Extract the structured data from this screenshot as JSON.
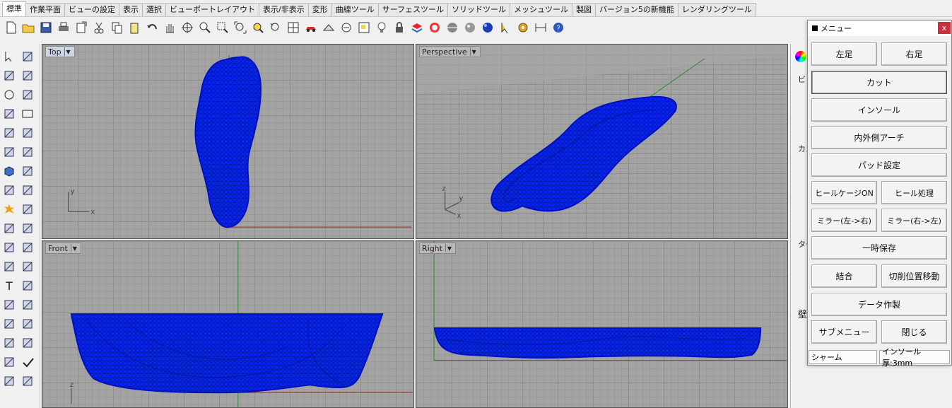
{
  "tabs": [
    "標準",
    "作業平面",
    "ビューの設定",
    "表示",
    "選択",
    "ビューポートレイアウト",
    "表示/非表示",
    "変形",
    "曲線ツール",
    "サーフェスツール",
    "ソリッドツール",
    "メッシュツール",
    "製図",
    "バージョン5の新機能",
    "レンダリングツール"
  ],
  "toolbar_icons": [
    "new-file-icon",
    "open-folder-icon",
    "save-icon",
    "print-icon",
    "import-icon",
    "cut-icon",
    "copy-icon",
    "paste-icon",
    "undo-icon",
    "pan-hand-icon",
    "rotate-view-icon",
    "zoom-icon",
    "zoom-window-icon",
    "zoom-extents-icon",
    "zoom-selected-icon",
    "undo-view-icon",
    "four-viewports-icon",
    "car-icon",
    "object-properties-icon",
    "point-osnap-icon",
    "grid-snap-icon",
    "light-bulb-icon",
    "lock-icon",
    "layer-icon",
    "color-wheel-icon",
    "shaded-sphere-icon",
    "rendered-sphere-icon",
    "blue-sphere-icon",
    "select-arrow-icon",
    "gear-options-icon",
    "dimension-icon",
    "help-icon"
  ],
  "viewports": {
    "top": {
      "label": "Top"
    },
    "perspective": {
      "label": "Perspective"
    },
    "front": {
      "label": "Front"
    },
    "right": {
      "label": "Right"
    }
  },
  "axis_labels": {
    "x": "x",
    "y": "y",
    "z": "z"
  },
  "right_strip": {
    "chars": [
      "ビ",
      "カメ",
      "ター",
      "壁"
    ]
  },
  "menu": {
    "title": "メニュー",
    "close": "x",
    "buttons": {
      "left_foot": "左足",
      "right_foot": "右足",
      "cut": "カット",
      "insole": "インソール",
      "arch": "内外側アーチ",
      "pad": "パッド設定",
      "heel_cage": "ヒールケージON",
      "heel_process": "ヒール処理",
      "mirror_lr": "ミラー(左->右)",
      "mirror_rl": "ミラー(右->左)",
      "temp_save": "一時保存",
      "join": "結合",
      "move_cut": "切削位置移動",
      "make_data": "データ作製",
      "submenu": "サブメニュー",
      "close_btn": "閉じる"
    },
    "status_left": "シャーム",
    "status_right": "インソール厚:3mm"
  }
}
